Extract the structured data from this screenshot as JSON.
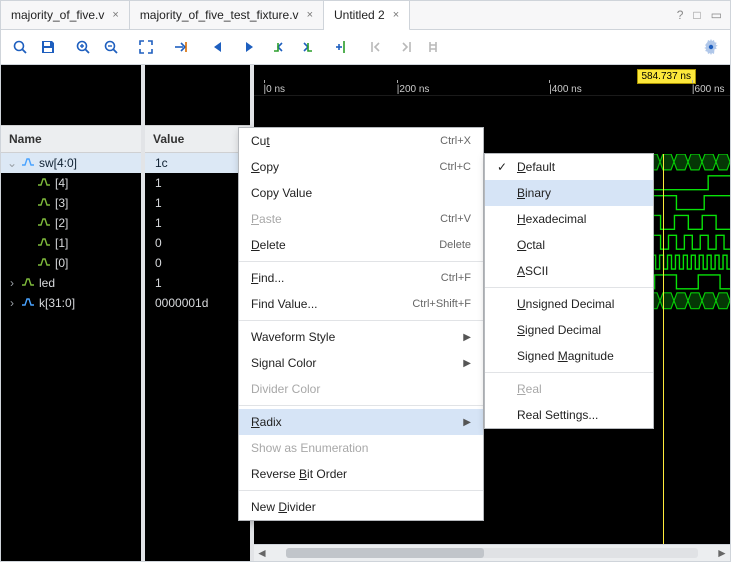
{
  "tabs": [
    {
      "label": "majority_of_five.v",
      "active": false
    },
    {
      "label": "majority_of_five_test_fixture.v",
      "active": false
    },
    {
      "label": "Untitled 2",
      "active": true
    }
  ],
  "columns": {
    "name": "Name",
    "value": "Value"
  },
  "signals": [
    {
      "name": "sw[4:0]",
      "value": "1c",
      "kind": "bus",
      "expanded": true,
      "depth": 0,
      "selected": true
    },
    {
      "name": "[4]",
      "value": "1",
      "kind": "bit",
      "depth": 1
    },
    {
      "name": "[3]",
      "value": "1",
      "kind": "bit",
      "depth": 1
    },
    {
      "name": "[2]",
      "value": "1",
      "kind": "bit",
      "depth": 1
    },
    {
      "name": "[1]",
      "value": "0",
      "kind": "bit",
      "depth": 1
    },
    {
      "name": "[0]",
      "value": "0",
      "kind": "bit",
      "depth": 1
    },
    {
      "name": "led",
      "value": "1",
      "kind": "bit",
      "depth": 0
    },
    {
      "name": "k[31:0]",
      "value": "0000001d",
      "kind": "bus",
      "expanded": false,
      "depth": 0
    }
  ],
  "ruler": {
    "ticks": [
      {
        "label": "0 ns",
        "pos": 2
      },
      {
        "label": "200 ns",
        "pos": 30
      },
      {
        "label": "400 ns",
        "pos": 62
      },
      {
        "label": "600 ns",
        "pos": 92
      }
    ],
    "marker": "584.737 ns",
    "cursor_pct": 86
  },
  "ctx_main": [
    {
      "label": "Cut",
      "u": "t",
      "sc": "Ctrl+X"
    },
    {
      "label": "Copy",
      "u": "C",
      "sc": "Ctrl+C"
    },
    {
      "label": "Copy Value"
    },
    {
      "label": "Paste",
      "u": "P",
      "sc": "Ctrl+V",
      "disabled": true
    },
    {
      "label": "Delete",
      "u": "D",
      "sc": "Delete"
    },
    {
      "sep": true
    },
    {
      "label": "Find...",
      "u": "F",
      "sc": "Ctrl+F"
    },
    {
      "label": "Find Value...",
      "u": "",
      "sc": "Ctrl+Shift+F"
    },
    {
      "sep": true
    },
    {
      "label": "Waveform Style",
      "sub": true
    },
    {
      "label": "Signal Color",
      "sub": true
    },
    {
      "label": "Divider Color",
      "disabled": true
    },
    {
      "sep": true
    },
    {
      "label": "Radix",
      "u": "R",
      "sub": true,
      "hover": true
    },
    {
      "label": "Show as Enumeration",
      "disabled": true
    },
    {
      "label": "Reverse Bit Order",
      "u": "B"
    },
    {
      "sep": true
    },
    {
      "label": "New Divider",
      "u": "D"
    }
  ],
  "ctx_radix": [
    {
      "label": "Default",
      "u": "D",
      "checked": true
    },
    {
      "label": "Binary",
      "u": "B",
      "hover": true
    },
    {
      "label": "Hexadecimal",
      "u": "H"
    },
    {
      "label": "Octal",
      "u": "O"
    },
    {
      "label": "ASCII",
      "u": "A"
    },
    {
      "sep": true
    },
    {
      "label": "Unsigned Decimal",
      "u": "U"
    },
    {
      "label": "Signed Decimal",
      "u": "S"
    },
    {
      "label": "Signed Magnitude",
      "u": "M"
    },
    {
      "sep": true
    },
    {
      "label": "Real",
      "u": "R",
      "disabled": true
    },
    {
      "label": "Real Settings..."
    }
  ]
}
